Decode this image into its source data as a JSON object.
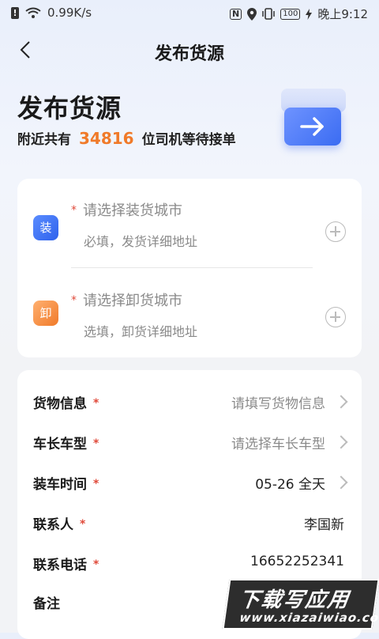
{
  "status_bar": {
    "speed": "0.99K/s",
    "nfc": "N",
    "battery": "100",
    "time": "晚上9:12"
  },
  "nav": {
    "title": "发布货源"
  },
  "hero": {
    "title": "发布货源",
    "sub_prefix": "附近共有",
    "driver_count": "34816",
    "sub_suffix": "位司机等待接单"
  },
  "address": {
    "load": {
      "badge": "装",
      "placeholder": "请选择装货城市",
      "hint": "必填，发货详细地址"
    },
    "unload": {
      "badge": "卸",
      "placeholder": "请选择卸货城市",
      "hint": "选填，卸货详细地址"
    }
  },
  "form": {
    "rows": [
      {
        "label": "货物信息",
        "required": "*",
        "value": "请填写货物信息"
      },
      {
        "label": "车长车型",
        "required": "*",
        "value": "请选择车长车型"
      },
      {
        "label": "装车时间",
        "required": "*",
        "value": "05-26 全天"
      },
      {
        "label": "联系人",
        "required": "*",
        "value": "李国新"
      },
      {
        "label": "联系电话",
        "required": "*",
        "value": "16652252341"
      },
      {
        "label": "备注",
        "required": "",
        "value": ""
      }
    ]
  },
  "watermark": {
    "title": "下载写应用",
    "url": "www.xiazaiwiao.com"
  },
  "colors": {
    "accent": "#f07a29",
    "primary": "#3b6cf2",
    "required": "#e04a3a"
  },
  "icons": {
    "back": "chevron-left-icon",
    "plus": "plus-circle-icon",
    "arrow": "arrow-right-icon"
  }
}
